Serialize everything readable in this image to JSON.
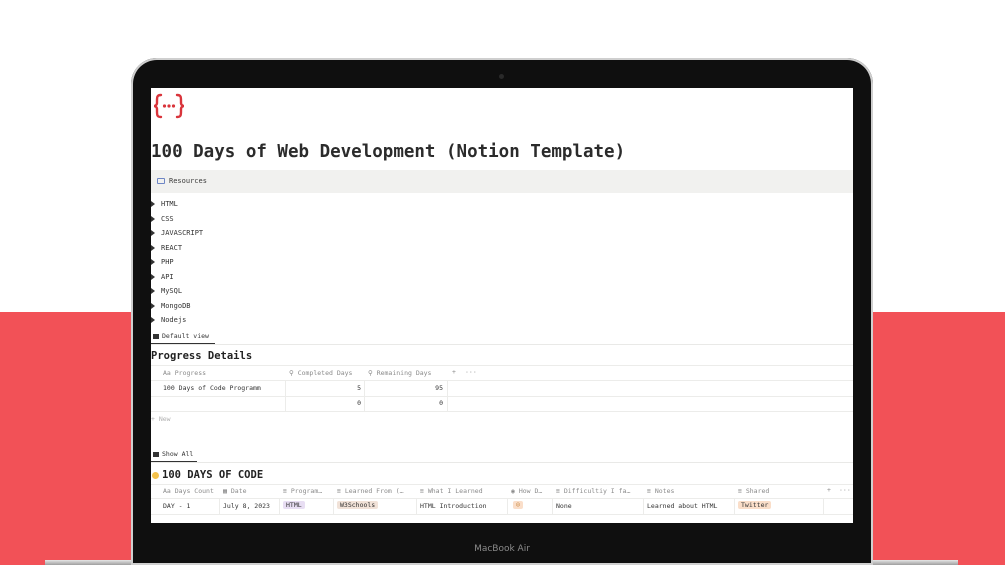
{
  "laptop": {
    "brand": "MacBook Air"
  },
  "page": {
    "title": "100 Days of Web Development (Notion Template)",
    "callout": "Resources",
    "toggles": [
      "HTML",
      "CSS",
      "JAVASCRIPT",
      "REACT",
      "PHP",
      "API",
      "MySQL",
      "MongoDB",
      "Nodejs"
    ]
  },
  "progress": {
    "view_label": "Default view",
    "title": "Progress Details",
    "columns": [
      "Aa Progress",
      "Completed Days",
      "Remaining Days"
    ],
    "add": "+",
    "more": "···",
    "rows": [
      {
        "name": "100 Days of Code Programm",
        "completed": "5",
        "remaining": "95"
      },
      {
        "name": "",
        "completed": "0",
        "remaining": "0"
      }
    ],
    "new_label": "+ New"
  },
  "code": {
    "view_label": "Show All",
    "title": "100 DAYS OF CODE",
    "columns": [
      "Aa Days Count",
      "Date",
      "Program…",
      "Learned From (…",
      "What I Learned",
      "How D…",
      "Difficultiy I fa…",
      "Notes",
      "Shared"
    ],
    "add": "+",
    "more": "···",
    "row": {
      "days": "DAY - 1",
      "date": "July 8, 2023",
      "program": "HTML",
      "learned_from": "W3Schools",
      "what": "HTML Introduction",
      "how": "☺",
      "difficulty": "None",
      "notes": "Learned about HTML",
      "shared": "Twitter"
    }
  },
  "colors": {
    "background_red": "#f25157",
    "logo_red": "#d9343b",
    "tag_purple": "#e8def3",
    "tag_brown": "#f1e2d8",
    "tag_orange": "#fadec9",
    "emoji_yellow": "#f5c24b"
  }
}
